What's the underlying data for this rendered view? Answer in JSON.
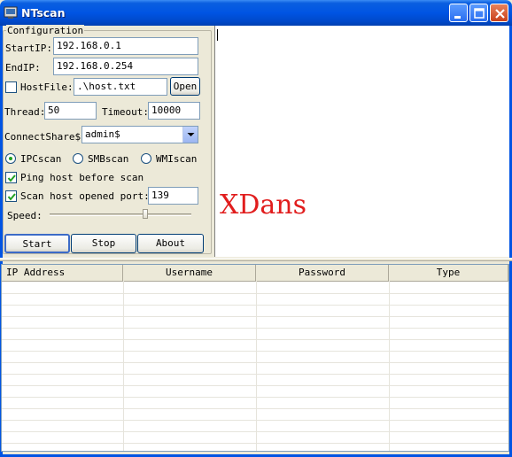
{
  "window": {
    "title": "NTscan",
    "icons": [
      "app-icon",
      "minimize-icon",
      "maximize-icon",
      "close-icon"
    ]
  },
  "config": {
    "legend": "Configuration",
    "start_ip_label": "StartIP:",
    "start_ip_value": "192.168.0.1",
    "end_ip_label": "EndIP:",
    "end_ip_value": "192.168.0.254",
    "hostfile_label": "HostFile:",
    "hostfile_value": ".\\host.txt",
    "open_label": "Open",
    "thread_label": "Thread:",
    "thread_value": "50",
    "timeout_label": "Timeout:",
    "timeout_value": "10000",
    "connectshare_label": "ConnectShare$:",
    "connectshare_value": "admin$",
    "radios": {
      "ipc": "IPCscan",
      "smb": "SMBscan",
      "wmi": "WMIscan",
      "selected": "IPCscan"
    },
    "ping_label": "Ping host before scan",
    "ping_checked": true,
    "scanport_label": "Scan host opened port:",
    "scanport_checked": true,
    "scanport_value": "139",
    "hostfile_checked": false,
    "speed_label": "Speed:",
    "speed_level": 0.68
  },
  "buttons": {
    "start": "Start",
    "stop": "Stop",
    "about": "About"
  },
  "output": {
    "brand": "XDans"
  },
  "table": {
    "columns": [
      "IP Address",
      "Username",
      "Password",
      "Type"
    ],
    "rows": []
  },
  "colors": {
    "titlebar": "#0054e3",
    "brand": "#e11d1d"
  }
}
